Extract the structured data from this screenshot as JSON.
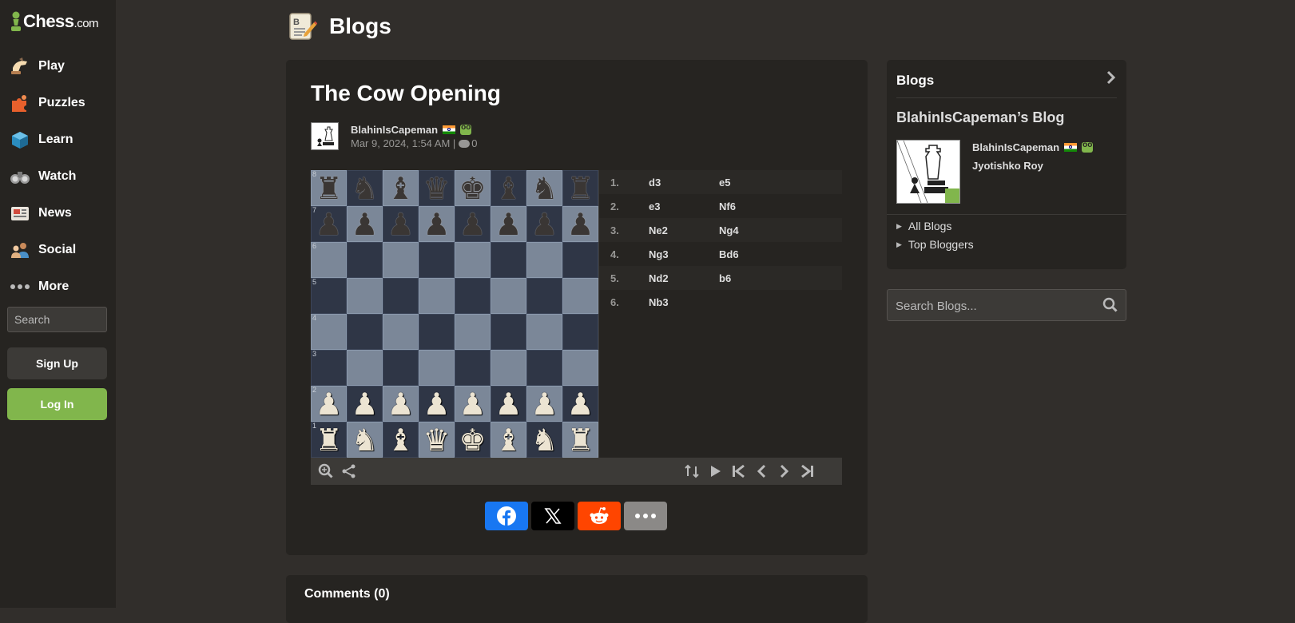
{
  "brand": {
    "name": "Chess",
    "suffix": ".com",
    "accent": "#81b64c"
  },
  "nav": [
    {
      "label": "Play",
      "icon": "play-hand-icon"
    },
    {
      "label": "Puzzles",
      "icon": "puzzle-icon"
    },
    {
      "label": "Learn",
      "icon": "learn-cube-icon"
    },
    {
      "label": "Watch",
      "icon": "binoculars-icon"
    },
    {
      "label": "News",
      "icon": "newspaper-icon"
    },
    {
      "label": "Social",
      "icon": "social-people-icon"
    },
    {
      "label": "More",
      "icon": "more-dots-icon"
    }
  ],
  "sidebar_search": {
    "placeholder": "Search"
  },
  "auth": {
    "signup": "Sign Up",
    "login": "Log In"
  },
  "page": {
    "title": "Blogs"
  },
  "article": {
    "title": "The Cow Opening",
    "author": "BlahinIsCapeman",
    "date": "Mar 9, 2024, 1:54 AM |",
    "comment_count": "0"
  },
  "game": {
    "moves": [
      {
        "num": "1.",
        "white": "d3",
        "black": "e5"
      },
      {
        "num": "2.",
        "white": "e3",
        "black": "Nf6"
      },
      {
        "num": "3.",
        "white": "Ne2",
        "black": "Ng4"
      },
      {
        "num": "4.",
        "white": "Ng3",
        "black": "Bd6"
      },
      {
        "num": "5.",
        "white": "Nd2",
        "black": "b6"
      },
      {
        "num": "6.",
        "white": "Nb3",
        "black": ""
      }
    ],
    "ranks": [
      "8",
      "7",
      "6",
      "5",
      "4",
      "3",
      "2",
      "1"
    ]
  },
  "comments": {
    "title": "Comments (0)"
  },
  "blogs_panel": {
    "title": "Blogs",
    "blog_name": "BlahinIsCapeman’s Blog",
    "username": "BlahinIsCapeman",
    "real_name": "Jyotishko Roy",
    "links": [
      "All Blogs",
      "Top Bloggers"
    ]
  },
  "blog_search": {
    "placeholder": "Search Blogs..."
  }
}
